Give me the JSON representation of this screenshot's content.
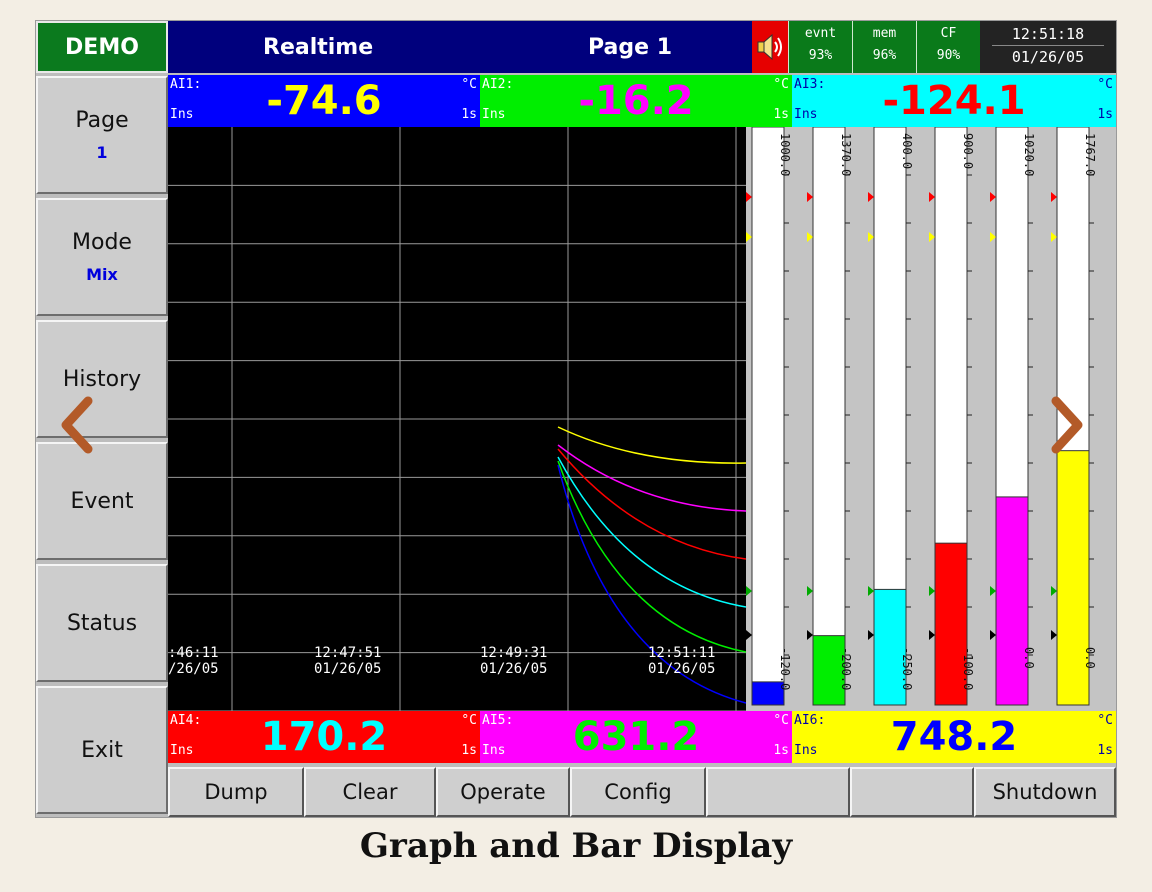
{
  "topbar": {
    "demo": "DEMO",
    "mode_title": "Realtime",
    "page_title": "Page 1",
    "status": [
      {
        "label": "evnt",
        "value": "93%"
      },
      {
        "label": "mem",
        "value": "96%"
      },
      {
        "label": "CF",
        "value": "90%"
      }
    ],
    "time": "12:51:18",
    "date": "01/26/05"
  },
  "nav": {
    "page_label": "Page",
    "page_value": "1",
    "mode_label": "Mode",
    "mode_value": "Mix",
    "history": "History",
    "event": "Event",
    "status": "Status",
    "exit": "Exit"
  },
  "channels": [
    {
      "name": "AI1:",
      "state": "Ins",
      "unit": "°C",
      "rate": "1s",
      "value": "-74.6",
      "bg": "#0000ff",
      "fg": "#ffff00",
      "label_color": "#ffffff"
    },
    {
      "name": "AI2:",
      "state": "Ins",
      "unit": "°C",
      "rate": "1s",
      "value": "-16.2",
      "bg": "#00ee00",
      "fg": "#ff00ff",
      "label_color": "#ffffff"
    },
    {
      "name": "AI3:",
      "state": "Ins",
      "unit": "°C",
      "rate": "1s",
      "value": "-124.1",
      "bg": "#00ffff",
      "fg": "#ff0000",
      "label_color": "#0000aa"
    },
    {
      "name": "AI4:",
      "state": "Ins",
      "unit": "°C",
      "rate": "1s",
      "value": "170.2",
      "bg": "#ff0000",
      "fg": "#00ffff",
      "label_color": "#ffffff"
    },
    {
      "name": "AI5:",
      "state": "Ins",
      "unit": "°C",
      "rate": "1s",
      "value": "631.2",
      "bg": "#ff00ff",
      "fg": "#00ee00",
      "label_color": "#ffffff"
    },
    {
      "name": "AI6:",
      "state": "Ins",
      "unit": "°C",
      "rate": "1s",
      "value": "748.2",
      "bg": "#ffff00",
      "fg": "#0000ff",
      "label_color": "#0000aa"
    }
  ],
  "graph": {
    "time_labels": [
      {
        "time": ":46:11",
        "date": "/26/05"
      },
      {
        "time": "12:47:51",
        "date": "01/26/05"
      },
      {
        "time": "12:49:31",
        "date": "01/26/05"
      },
      {
        "time": "12:51:11",
        "date": "01/26/05"
      }
    ],
    "trace_colors": [
      "#ffff00",
      "#ff00ff",
      "#ff0000",
      "#00ffff",
      "#00ee00",
      "#0000ff"
    ]
  },
  "bars": [
    {
      "top": "1000.0",
      "bottom": "-120.0",
      "fill": 0.04,
      "color": "#0000ff"
    },
    {
      "top": "1370.0",
      "bottom": "-200.0",
      "fill": 0.12,
      "color": "#00ee00"
    },
    {
      "top": "400.0",
      "bottom": "-250.0",
      "fill": 0.2,
      "color": "#00ffff"
    },
    {
      "top": "900.0",
      "bottom": "-100.0",
      "fill": 0.28,
      "color": "#ff0000"
    },
    {
      "top": "1020.0",
      "bottom": "0.0",
      "fill": 0.36,
      "color": "#ff00ff"
    },
    {
      "top": "1767.0",
      "bottom": "0.0",
      "fill": 0.44,
      "color": "#ffff00"
    }
  ],
  "footer": {
    "dump": "Dump",
    "clear": "Clear",
    "operate": "Operate",
    "config": "Config",
    "blank": "",
    "shutdown": "Shutdown"
  },
  "caption": "Graph and Bar Display"
}
